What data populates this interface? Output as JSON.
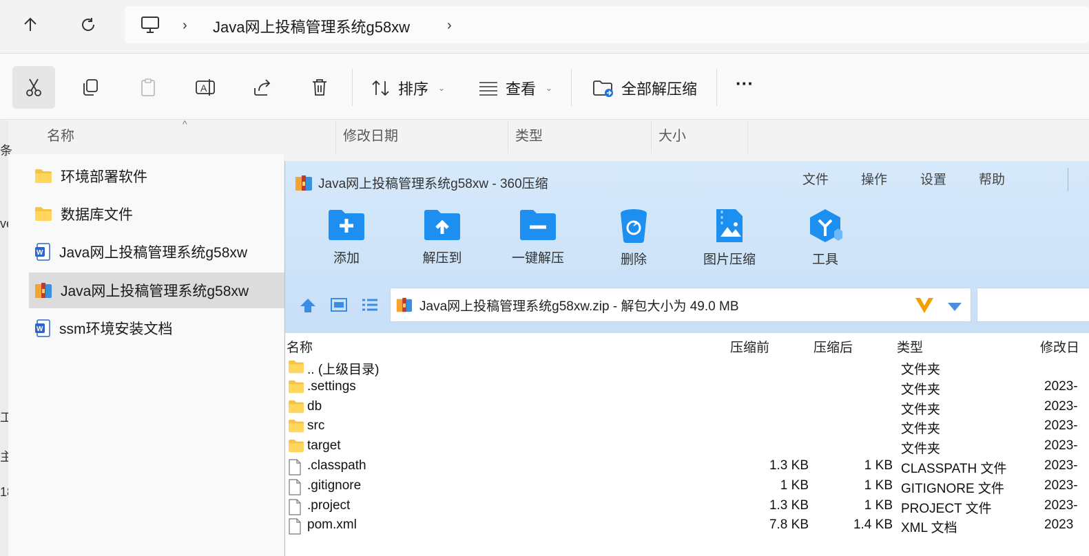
{
  "address": {
    "up_icon": "arrow-up-icon",
    "refresh_icon": "refresh-icon",
    "pc_icon": "computer-icon",
    "path": "Java网上投稿管理系统g58xw"
  },
  "toolbar": {
    "sort_label": "排序",
    "view_label": "查看",
    "extract_all_label": "全部解压缩",
    "more_label": "···"
  },
  "columns": {
    "name": "名称",
    "modified": "修改日期",
    "type": "类型",
    "size": "大小"
  },
  "left_fragments": [
    "条",
    "ve",
    "工",
    "主",
    "18"
  ],
  "files": [
    {
      "name": "环境部署软件",
      "icon": "folder-icon"
    },
    {
      "name": "数据库文件",
      "icon": "folder-icon"
    },
    {
      "name": "Java网上投稿管理系统g58xw",
      "icon": "word-doc-icon"
    },
    {
      "name": "Java网上投稿管理系统g58xw",
      "icon": "zip-archive-icon"
    },
    {
      "name": "ssm环境安装文档",
      "icon": "word-doc-icon"
    }
  ],
  "zip": {
    "title": "Java网上投稿管理系统g58xw - 360压缩",
    "menu": [
      "文件",
      "操作",
      "设置",
      "帮助"
    ],
    "tools": [
      {
        "label": "添加",
        "icon": "add-icon"
      },
      {
        "label": "解压到",
        "icon": "extract-to-icon"
      },
      {
        "label": "一键解压",
        "icon": "one-click-extract-icon"
      },
      {
        "label": "删除",
        "icon": "delete-icon"
      },
      {
        "label": "图片压缩",
        "icon": "image-compress-icon"
      },
      {
        "label": "工具",
        "icon": "tools-icon"
      }
    ],
    "path_text": "Java网上投稿管理系统g58xw.zip - 解包大小为 49.0 MB",
    "columns": {
      "name": "名称",
      "before": "压缩前",
      "after": "压缩后",
      "type": "类型",
      "modified": "修改日"
    },
    "rows": [
      {
        "name": ".. (上级目录)",
        "before": "",
        "after": "",
        "type": "文件夹",
        "modified": "",
        "icon": "folder-icon"
      },
      {
        "name": ".settings",
        "before": "",
        "after": "",
        "type": "文件夹",
        "modified": "2023-",
        "icon": "folder-icon"
      },
      {
        "name": "db",
        "before": "",
        "after": "",
        "type": "文件夹",
        "modified": "2023-",
        "icon": "folder-icon"
      },
      {
        "name": "src",
        "before": "",
        "after": "",
        "type": "文件夹",
        "modified": "2023-",
        "icon": "folder-icon"
      },
      {
        "name": "target",
        "before": "",
        "after": "",
        "type": "文件夹",
        "modified": "2023-",
        "icon": "folder-icon"
      },
      {
        "name": ".classpath",
        "before": "1.3 KB",
        "after": "1 KB",
        "type": "CLASSPATH 文件",
        "modified": "2023-",
        "icon": "file-icon"
      },
      {
        "name": ".gitignore",
        "before": "1 KB",
        "after": "1 KB",
        "type": "GITIGNORE 文件",
        "modified": "2023-",
        "icon": "file-icon"
      },
      {
        "name": ".project",
        "before": "1.3 KB",
        "after": "1 KB",
        "type": "PROJECT 文件",
        "modified": "2023-",
        "icon": "file-icon"
      },
      {
        "name": "pom.xml",
        "before": "7.8 KB",
        "after": "1.4 KB",
        "type": "XML 文档",
        "modified": "2023",
        "icon": "file-icon"
      }
    ]
  }
}
